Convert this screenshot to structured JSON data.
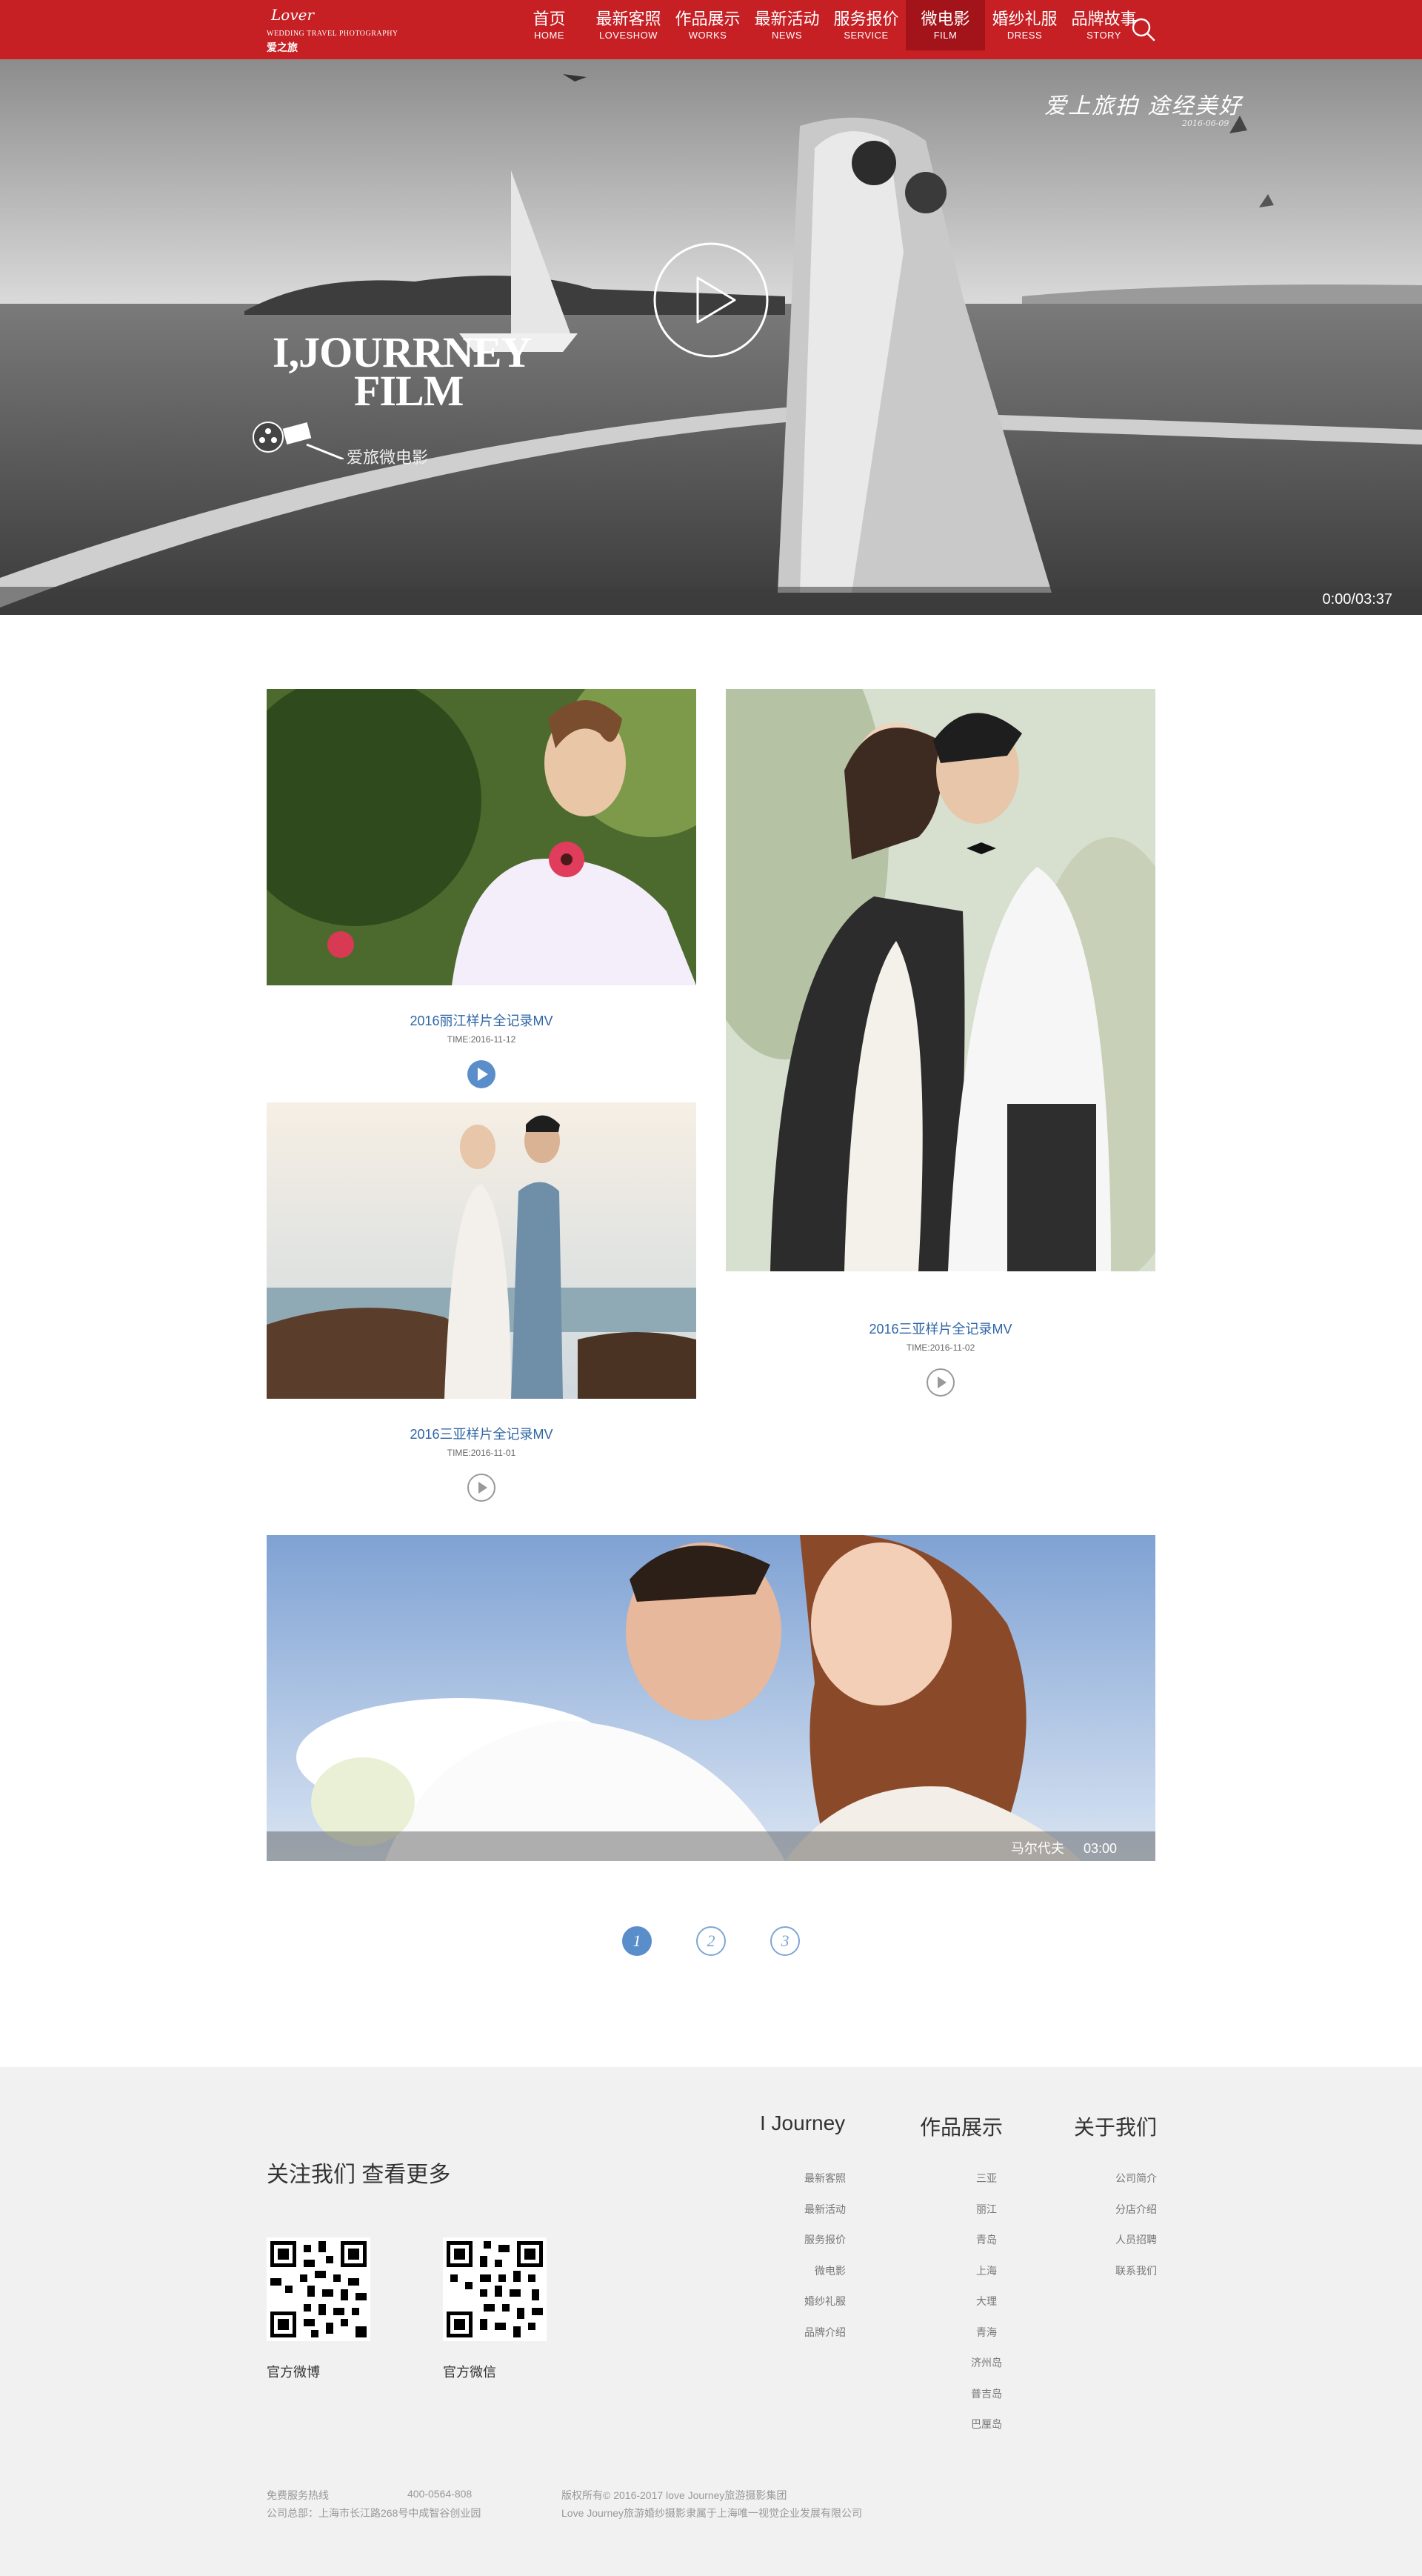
{
  "header": {
    "logo": {
      "script": "Lover",
      "sub": "WEDDING TRAVEL PHOTOGRAPHY",
      "cn": "爱之旅"
    },
    "nav": [
      {
        "cn": "首页",
        "en": "HOME"
      },
      {
        "cn": "最新客照",
        "en": "LOVESHOW"
      },
      {
        "cn": "作品展示",
        "en": "WORKS"
      },
      {
        "cn": "最新活动",
        "en": "NEWS"
      },
      {
        "cn": "服务报价",
        "en": "SERVICE"
      },
      {
        "cn": "微电影",
        "en": "FILM"
      },
      {
        "cn": "婚纱礼服",
        "en": "DRESS"
      },
      {
        "cn": "品牌故事",
        "en": "STORY"
      }
    ],
    "active_nav": "FILM",
    "search_icon": "search-icon",
    "colors": {
      "brand": "#c61f24",
      "active": "#a3141a"
    }
  },
  "hero": {
    "title_line1": "I,JOURRNEY",
    "title_line2": "FILM",
    "subtitle": "爱旅微电影",
    "slogan": "爱上旅拍 途经美好",
    "slogan_date": "2016-06-09",
    "time": "0:00/03:37",
    "play_icon": "play-circle-icon"
  },
  "videos": [
    {
      "title": "2016丽江样片全记录MV",
      "time": "TIME:2016-11-12"
    },
    {
      "title": "2016三亚样片全记录MV",
      "time": "TIME:2016-11-02"
    },
    {
      "title": "2016三亚样片全记录MV",
      "time": "TIME:2016-11-01"
    }
  ],
  "featured": {
    "title": "马尔代夫",
    "duration": "03:00"
  },
  "pagination": {
    "pages": [
      "1",
      "2",
      "3"
    ],
    "current": "1",
    "color": "#5a8ecb"
  },
  "footer": {
    "follow": "关注我们 查看更多",
    "qr": [
      {
        "label": "官方微博"
      },
      {
        "label": "官方微信"
      }
    ],
    "columns": [
      {
        "heading": "I Journey",
        "links": [
          "最新客照",
          "最新活动",
          "服务报价",
          "微电影",
          "婚纱礼服",
          "品牌介绍"
        ]
      },
      {
        "heading": "作品展示",
        "links": [
          "三亚",
          "丽江",
          "青岛",
          "上海",
          "大理",
          "青海",
          "济州岛",
          "普吉岛",
          "巴厘岛"
        ]
      },
      {
        "heading": "关于我们",
        "links": [
          "公司简介",
          "分店介绍",
          "人员招聘",
          "联系我们"
        ]
      }
    ],
    "hotline_label": "免费服务热线",
    "hotline": "400-0564-808",
    "address": "公司总部：上海市长江路268号中成智谷创业园",
    "copyright": "版权所有© 2016-2017 love Journey旅游摄影集团",
    "copyright2": "Love Journey旅游婚纱摄影隶属于上海唯一视觉企业发展有限公司"
  }
}
